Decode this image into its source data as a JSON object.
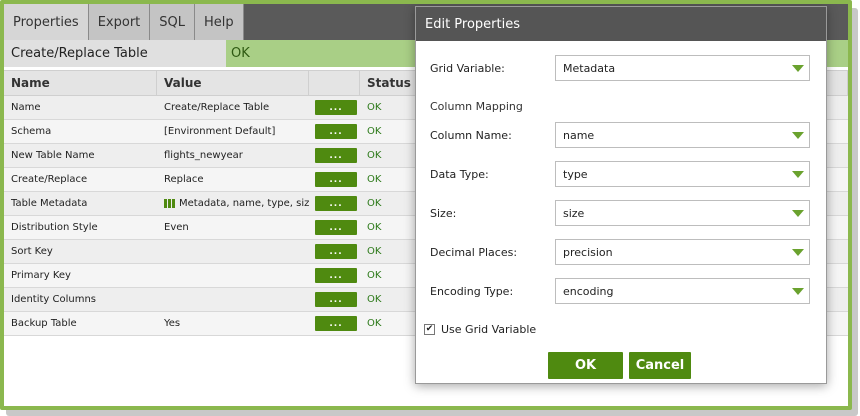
{
  "tabs": [
    "Properties",
    "Export",
    "SQL",
    "Help"
  ],
  "component": {
    "name": "Create/Replace Table",
    "status": "OK"
  },
  "table": {
    "headers": {
      "name": "Name",
      "value": "Value",
      "status": "Status"
    },
    "button_label": "...",
    "rows": [
      {
        "name": "Name",
        "value": "Create/Replace Table",
        "status": "OK"
      },
      {
        "name": "Schema",
        "value": "[Environment Default]",
        "status": "OK"
      },
      {
        "name": "New Table Name",
        "value": "flights_newyear",
        "status": "OK"
      },
      {
        "name": "Create/Replace",
        "value": "Replace",
        "status": "OK"
      },
      {
        "name": "Table Metadata",
        "value": "Metadata, name, type, siz...",
        "status": "OK"
      },
      {
        "name": "Distribution Style",
        "value": "Even",
        "status": "OK"
      },
      {
        "name": "Sort Key",
        "value": "",
        "status": "OK"
      },
      {
        "name": "Primary Key",
        "value": "",
        "status": "OK"
      },
      {
        "name": "Identity Columns",
        "value": "",
        "status": "OK"
      },
      {
        "name": "Backup Table",
        "value": "Yes",
        "status": "OK"
      }
    ]
  },
  "dialog": {
    "title": "Edit Properties",
    "grid_variable": {
      "label": "Grid Variable:",
      "value": "Metadata"
    },
    "section": "Column Mapping",
    "fields": [
      {
        "label": "Column Name:",
        "value": "name"
      },
      {
        "label": "Data Type:",
        "value": "type"
      },
      {
        "label": "Size:",
        "value": "size"
      },
      {
        "label": "Decimal Places:",
        "value": "precision"
      },
      {
        "label": "Encoding Type:",
        "value": "encoding"
      }
    ],
    "checkbox": {
      "label": "Use Grid Variable",
      "checked": true,
      "mark": "✔"
    },
    "ok": "OK",
    "cancel": "Cancel"
  },
  "colors": {
    "accent": "#4f8a10",
    "status_bg": "#a9cf86",
    "header": "#555555",
    "frame": "#8bb84e"
  }
}
